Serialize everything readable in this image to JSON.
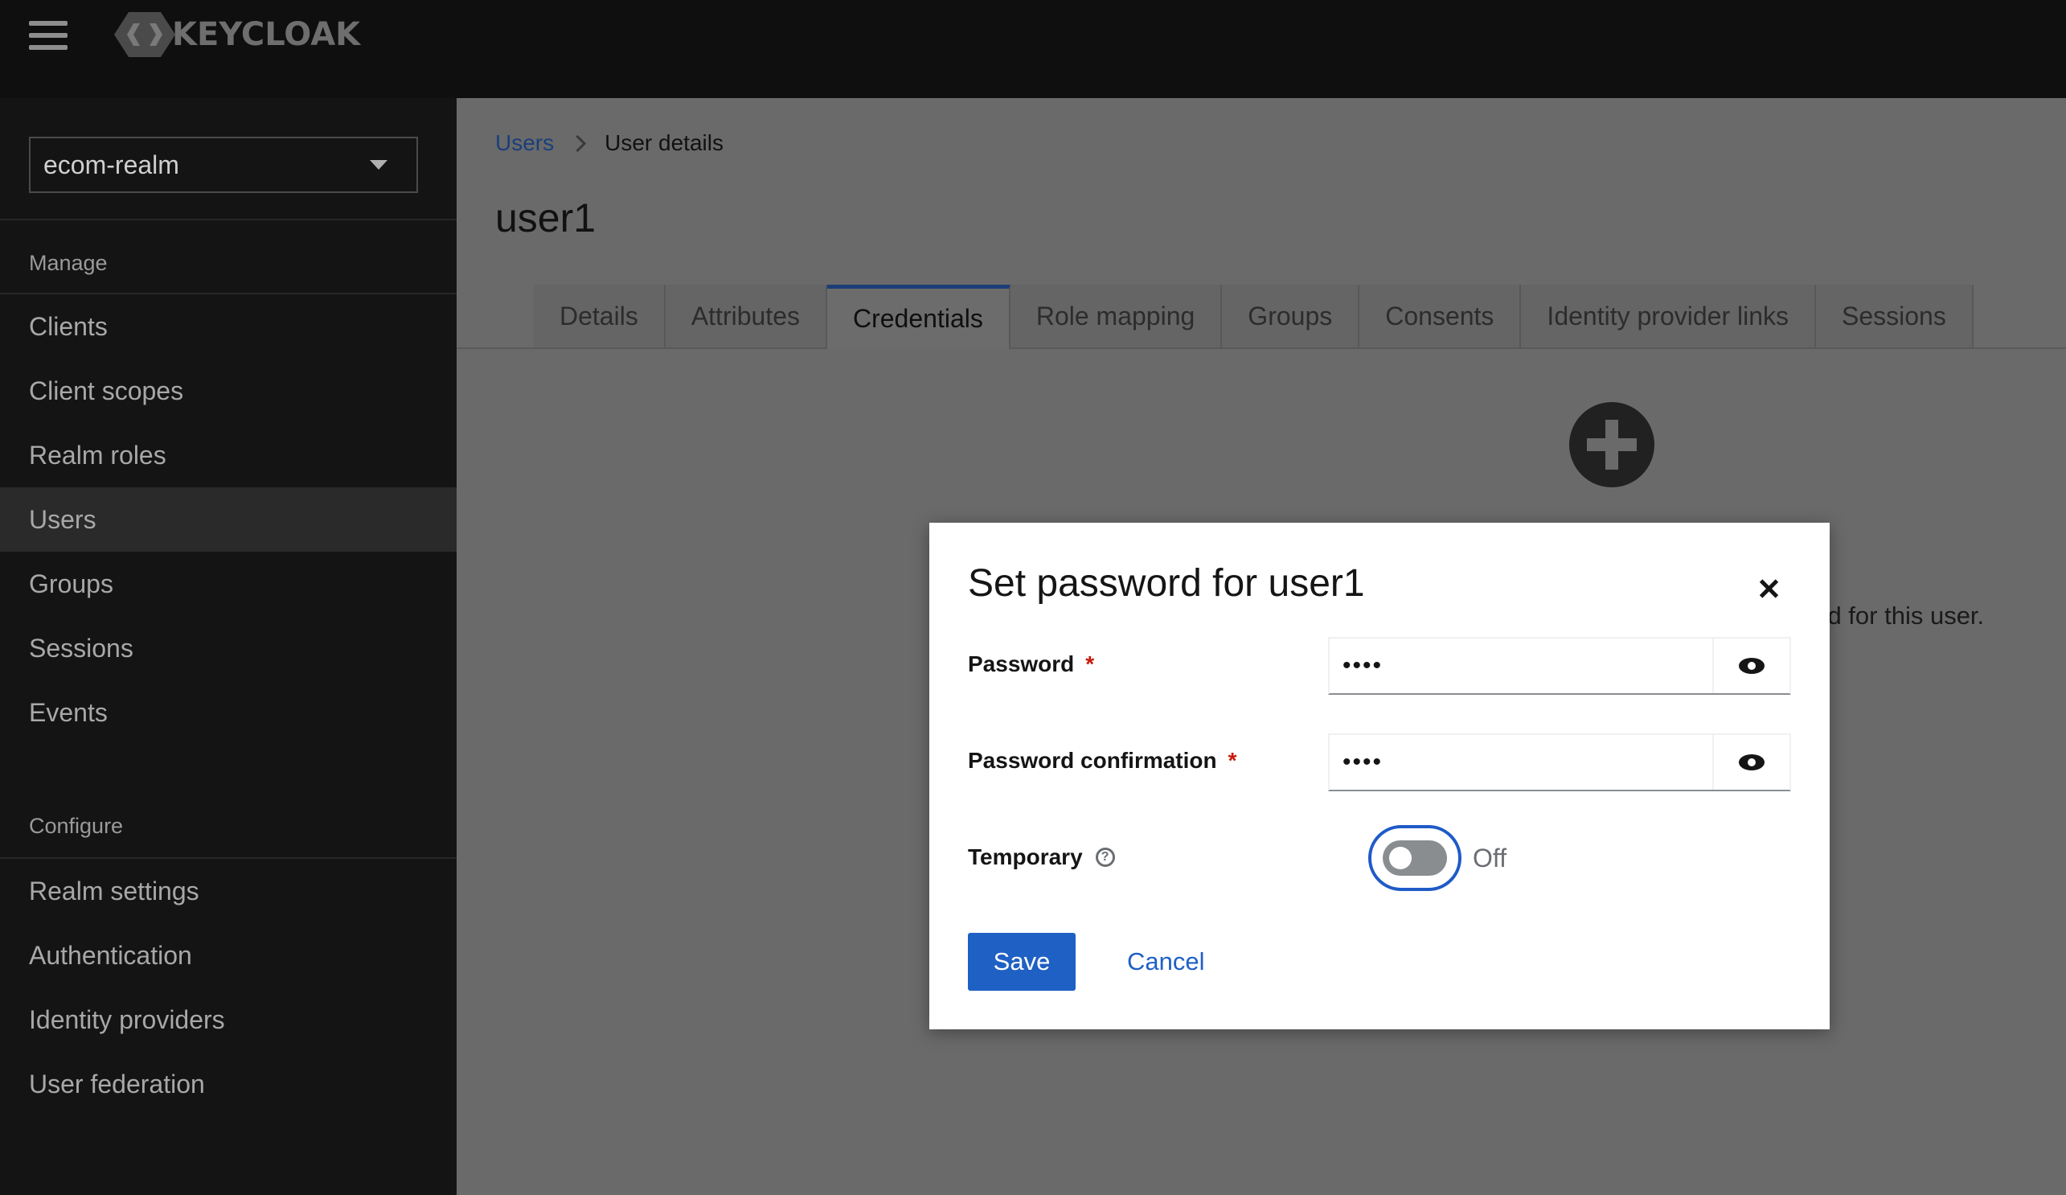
{
  "masthead": {
    "logo_text": "KEYCLOAK"
  },
  "sidebar": {
    "realm": "ecom-realm",
    "sections": [
      {
        "title": "Manage",
        "items": [
          "Clients",
          "Client scopes",
          "Realm roles",
          "Users",
          "Groups",
          "Sessions",
          "Events"
        ]
      },
      {
        "title": "Configure",
        "items": [
          "Realm settings",
          "Authentication",
          "Identity providers",
          "User federation"
        ]
      }
    ],
    "active_item": "Users"
  },
  "main": {
    "breadcrumb": {
      "link": "Users",
      "current": "User details"
    },
    "title": "user1",
    "tabs": [
      "Details",
      "Attributes",
      "Credentials",
      "Role mapping",
      "Groups",
      "Consents",
      "Identity provider links",
      "Sessions"
    ],
    "active_tab": "Credentials",
    "background_text": "sword for this user."
  },
  "modal": {
    "title": "Set password for user1",
    "password_label": "Password",
    "password_value": "••••",
    "confirm_label": "Password confirmation",
    "confirm_value": "••••",
    "required_mark": "*",
    "temporary_label": "Temporary",
    "help_glyph": "?",
    "temporary_state": "Off",
    "save_label": "Save",
    "cancel_label": "Cancel"
  },
  "icons": {
    "menu": "hamburger-icon",
    "logo": "keycloak-logo-icon",
    "dropdown": "caret-down-icon",
    "add": "plus-circle-icon",
    "close": "close-icon",
    "eye": "eye-icon",
    "help": "help-circle-icon"
  },
  "colors": {
    "primary": "#1f60c4",
    "required": "#c9190b",
    "masthead": "#0f0f0f",
    "sidebar": "#141414"
  }
}
